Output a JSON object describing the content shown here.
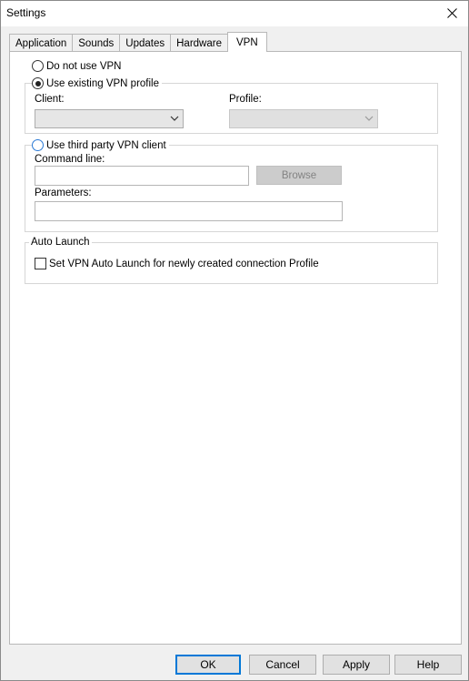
{
  "window": {
    "title": "Settings",
    "close_icon": "close-icon"
  },
  "tabs": [
    {
      "label": "Application",
      "active": false
    },
    {
      "label": "Sounds",
      "active": false
    },
    {
      "label": "Updates",
      "active": false
    },
    {
      "label": "Hardware",
      "active": false
    },
    {
      "label": "VPN",
      "active": true
    }
  ],
  "vpn": {
    "option_none": {
      "label": "Do not use VPN",
      "selected": false
    },
    "option_existing": {
      "label": "Use existing VPN profile",
      "selected": true
    },
    "client_label": "Client:",
    "client_value": "",
    "profile_label": "Profile:",
    "profile_value": "",
    "option_third_party": {
      "label": "Use third party VPN client",
      "selected": false
    },
    "command_line_label": "Command line:",
    "command_line_value": "",
    "browse_label": "Browse",
    "parameters_label": "Parameters:",
    "parameters_value": ""
  },
  "auto_launch": {
    "title": "Auto Launch",
    "checkbox_label": "Set VPN Auto Launch for newly created connection Profile",
    "checked": false
  },
  "footer": {
    "ok": "OK",
    "cancel": "Cancel",
    "apply": "Apply",
    "help": "Help"
  }
}
